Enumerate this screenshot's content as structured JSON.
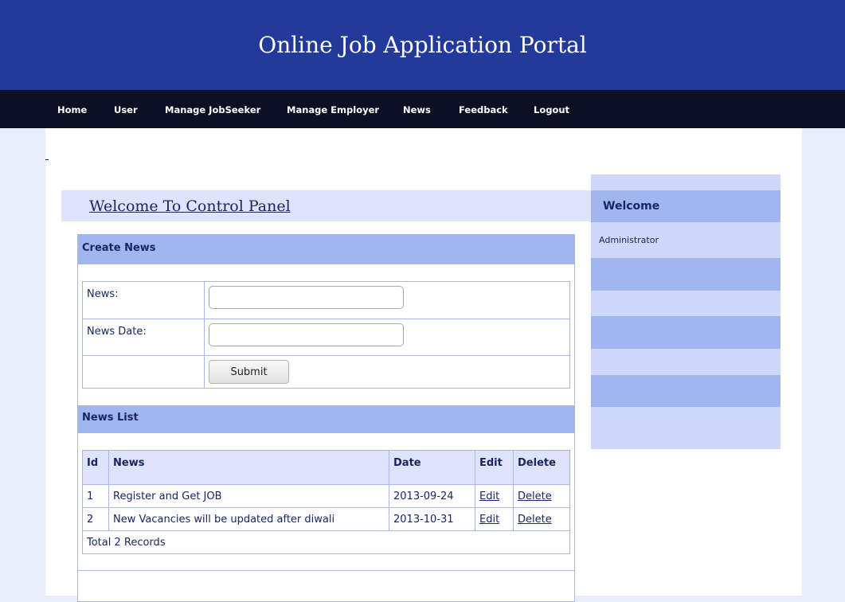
{
  "header": {
    "title": "Online Job Application Portal"
  },
  "nav": {
    "items": [
      {
        "label": "Home"
      },
      {
        "label": "User"
      },
      {
        "label": "Manage JobSeeker"
      },
      {
        "label": "Manage Employer"
      },
      {
        "label": "News"
      },
      {
        "label": "Feedback"
      },
      {
        "label": "Logout"
      }
    ]
  },
  "main": {
    "welcome_title": "Welcome To Control Panel",
    "create_news": {
      "heading": "Create News",
      "news_label": "News:",
      "news_value": "",
      "date_label": "News Date:",
      "date_value": "",
      "submit_label": "Submit"
    },
    "news_list": {
      "heading": "News List",
      "columns": [
        "Id",
        "News",
        "Date",
        "Edit",
        "Delete"
      ],
      "rows": [
        {
          "id": "1",
          "news": "Register and Get JOB",
          "date": "2013-09-24",
          "edit": "Edit",
          "delete": "Delete"
        },
        {
          "id": "2",
          "news": "New Vacancies will be updated after diwali",
          "date": "2013-10-31",
          "edit": "Edit",
          "delete": "Delete"
        }
      ],
      "total_text": "Total 2 Records"
    }
  },
  "sidebar": {
    "heading": "Welcome",
    "user": "Administrator"
  },
  "colors": {
    "header_bg": "#233a9a",
    "nav_bg": "#0d0f24",
    "section_head_bg": "#a1b6f0",
    "light_panel_bg": "#dfe3fc",
    "text": "#1a2660"
  }
}
